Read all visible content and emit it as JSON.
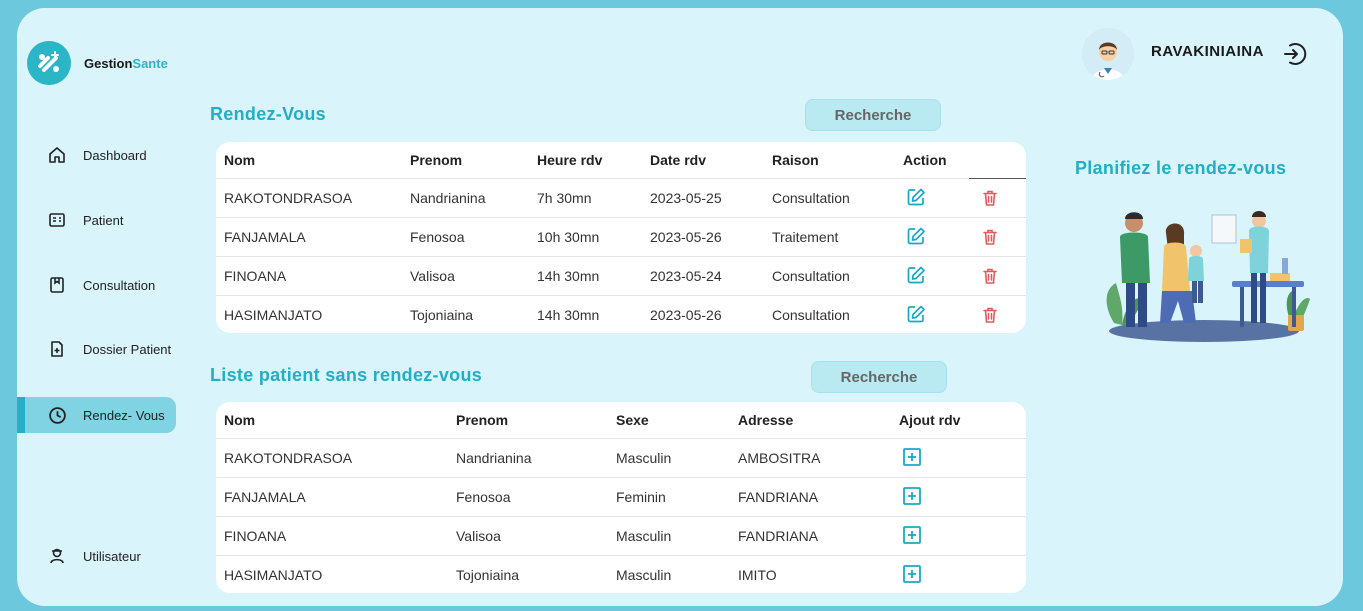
{
  "brand": {
    "name_part1": "Gestion",
    "name_part2": "Sante",
    "accent_color": "#2ab6c6"
  },
  "nav": {
    "items": [
      {
        "label": "Dashboard",
        "icon": "home-icon",
        "active": false
      },
      {
        "label": "Patient",
        "icon": "patient-list-icon",
        "active": false
      },
      {
        "label": "Consultation",
        "icon": "bookmark-icon",
        "active": false
      },
      {
        "label": "Dossier Patient",
        "icon": "file-add-icon",
        "active": false
      },
      {
        "label": "Rendez- Vous",
        "icon": "clock-icon",
        "active": true
      }
    ],
    "bottom_item": {
      "label": "Utilisateur",
      "icon": "user-icon"
    }
  },
  "user": {
    "name": "RAVAKINIAINA",
    "avatar_icon": "doctor-avatar",
    "logout_icon": "logout-icon"
  },
  "rendezvous": {
    "title": "Rendez-Vous",
    "search_label": "Recherche",
    "headers": [
      "Nom",
      "Prenom",
      "Heure rdv",
      "Date rdv",
      "Raison",
      "Action"
    ],
    "rows": [
      {
        "nom": "RAKOTONDRASOA",
        "prenom": "Nandrianina",
        "heure": "7h 30mn",
        "date": "2023-05-25",
        "raison": "Consultation"
      },
      {
        "nom": "FANJAMALA",
        "prenom": "Fenosoa",
        "heure": "10h 30mn",
        "date": "2023-05-26",
        "raison": "Traitement"
      },
      {
        "nom": "FINOANA",
        "prenom": "Valisoa",
        "heure": "14h 30mn",
        "date": "2023-05-24",
        "raison": "Consultation"
      },
      {
        "nom": "HASIMANJATO",
        "prenom": "Tojoniaina",
        "heure": "14h 30mn",
        "date": "2023-05-26",
        "raison": "Consultation"
      }
    ]
  },
  "sans_rdv": {
    "title": "Liste patient sans rendez-vous",
    "search_label": "Recherche",
    "headers": [
      "Nom",
      "Prenom",
      "Sexe",
      "Adresse",
      "Ajout rdv"
    ],
    "rows": [
      {
        "nom": "RAKOTONDRASOA",
        "prenom": "Nandrianina",
        "sexe": "Masculin",
        "adresse": "AMBOSITRA"
      },
      {
        "nom": "FANJAMALA",
        "prenom": "Fenosoa",
        "sexe": "Feminin",
        "adresse": "FANDRIANA"
      },
      {
        "nom": "FINOANA",
        "prenom": "Valisoa",
        "sexe": "Masculin",
        "adresse": "FANDRIANA"
      },
      {
        "nom": "HASIMANJATO",
        "prenom": "Tojoniaina",
        "sexe": "Masculin",
        "adresse": "IMITO"
      }
    ]
  },
  "side_panel": {
    "title": "Planifiez le rendez-vous",
    "illustration": "family-doctor-illustration"
  },
  "colors": {
    "edit": "#1aa7c4",
    "delete": "#e45a5a",
    "add": "#1aa7c4",
    "title": "#22aec6",
    "active_nav": "#7fd3e2"
  }
}
